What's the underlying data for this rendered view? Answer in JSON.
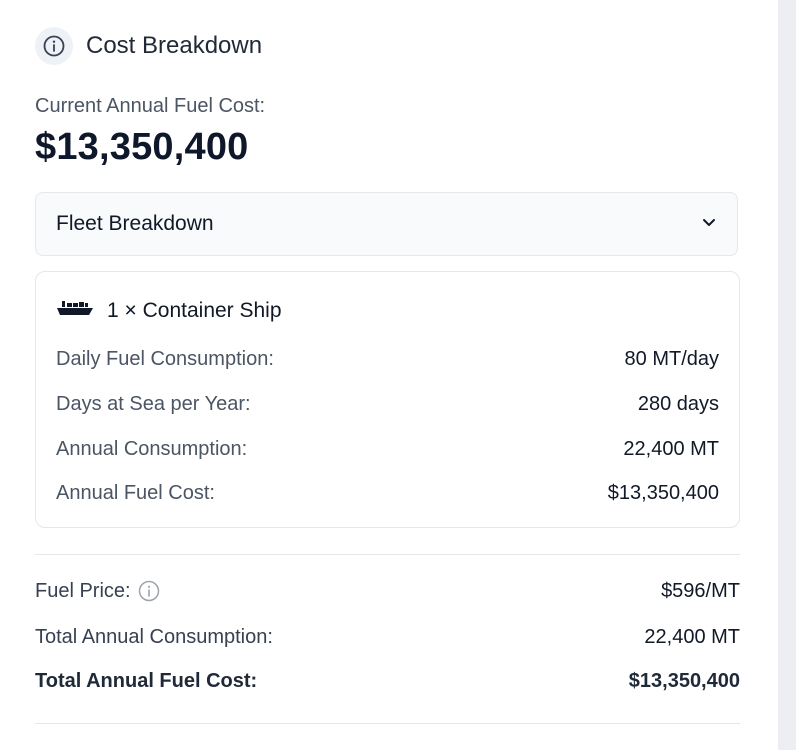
{
  "header": {
    "title": "Cost Breakdown",
    "icon": "info-icon"
  },
  "current": {
    "label": "Current Annual Fuel Cost:",
    "value": "$13,350,400"
  },
  "fleet_dropdown": {
    "label": "Fleet Breakdown",
    "icon": "chevron-down-icon"
  },
  "ship": {
    "icon": "ship-icon",
    "title": "1 × Container Ship",
    "rows": [
      {
        "label": "Daily Fuel Consumption:",
        "value": "80 MT/day"
      },
      {
        "label": "Days at Sea per Year:",
        "value": "280 days"
      },
      {
        "label": "Annual Consumption:",
        "value": "22,400 MT"
      },
      {
        "label": "Annual Fuel Cost:",
        "value": "$13,350,400"
      }
    ]
  },
  "summary": {
    "fuel_price": {
      "label": "Fuel Price:",
      "value": "$596/MT",
      "icon": "info-icon"
    },
    "total_consumption": {
      "label": "Total Annual Consumption:",
      "value": "22,400 MT"
    },
    "total_cost": {
      "label": "Total Annual Fuel Cost:",
      "value": "$13,350,400"
    }
  },
  "colors": {
    "border": "#e5e7eb",
    "muted_text": "#4b5563",
    "heading_text": "#0f172a"
  }
}
